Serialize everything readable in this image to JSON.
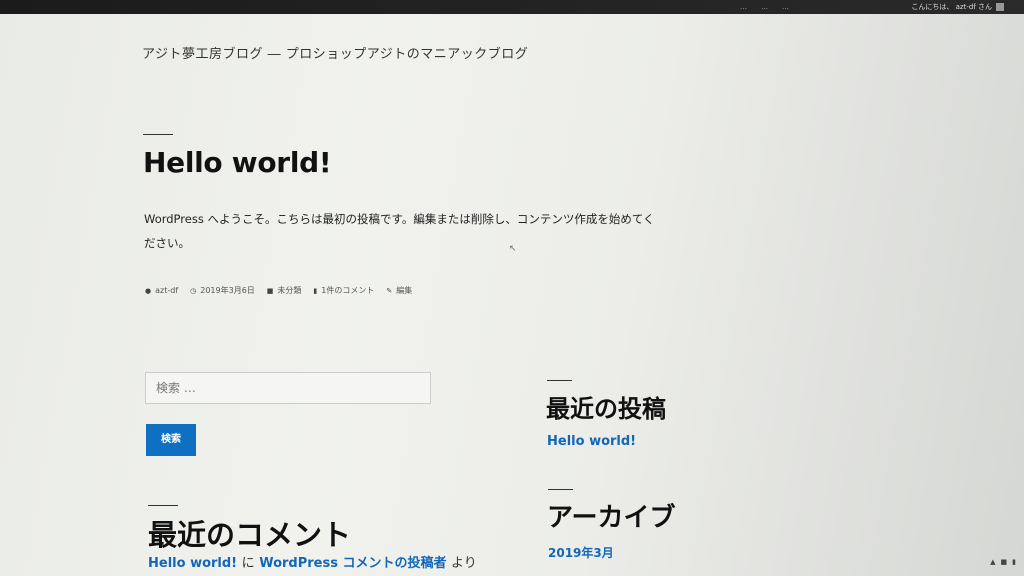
{
  "admin_bar": {
    "tab_items": [
      "…",
      "…",
      "…"
    ],
    "greeting": "こんにちは、 azt-df さん"
  },
  "site": {
    "title": "アジト夢工房ブログ ― プロショップアジトのマニアックブログ"
  },
  "post": {
    "title": "Hello world!",
    "content": "WordPress へようこそ。こちらは最初の投稿です。編集または削除し、コンテンツ作成を始めてください。",
    "meta": {
      "author": "azt-df",
      "date": "2019年3月6日",
      "category": "未分類",
      "comments": "1件のコメント",
      "edit": "編集"
    }
  },
  "search": {
    "placeholder": "検索 …",
    "button_label": "検索"
  },
  "widgets": {
    "recent_posts": {
      "title": "最近の投稿",
      "items": [
        "Hello world!"
      ]
    },
    "recent_comments": {
      "title": "最近のコメント",
      "post_link": "Hello world!",
      "on_text": "に",
      "author_link": "WordPress コメントの投稿者",
      "by_text": "より"
    },
    "archives": {
      "title": "アーカイブ",
      "items": [
        "2019年3月"
      ]
    }
  },
  "icons": {
    "author": "user-icon",
    "date": "clock-icon",
    "category": "folder-icon",
    "comments": "comment-icon",
    "edit": "pencil-icon"
  },
  "colors": {
    "link": "#1267b8",
    "button": "#0f6fc0",
    "admin_bar": "#1b1b1b"
  }
}
